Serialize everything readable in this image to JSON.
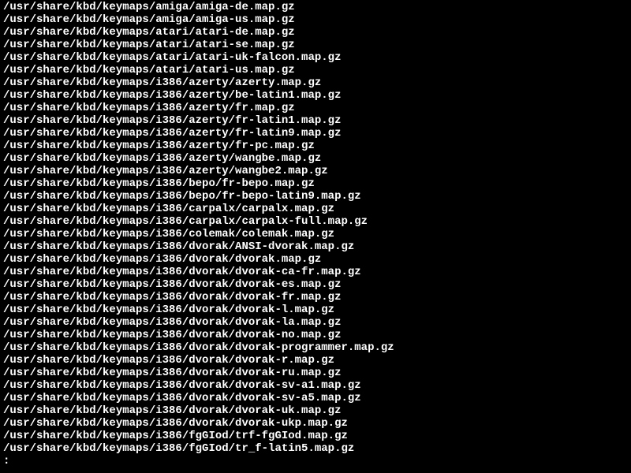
{
  "terminal": {
    "lines": [
      "/usr/share/kbd/keymaps/amiga/amiga-de.map.gz",
      "/usr/share/kbd/keymaps/amiga/amiga-us.map.gz",
      "/usr/share/kbd/keymaps/atari/atari-de.map.gz",
      "/usr/share/kbd/keymaps/atari/atari-se.map.gz",
      "/usr/share/kbd/keymaps/atari/atari-uk-falcon.map.gz",
      "/usr/share/kbd/keymaps/atari/atari-us.map.gz",
      "/usr/share/kbd/keymaps/i386/azerty/azerty.map.gz",
      "/usr/share/kbd/keymaps/i386/azerty/be-latin1.map.gz",
      "/usr/share/kbd/keymaps/i386/azerty/fr.map.gz",
      "/usr/share/kbd/keymaps/i386/azerty/fr-latin1.map.gz",
      "/usr/share/kbd/keymaps/i386/azerty/fr-latin9.map.gz",
      "/usr/share/kbd/keymaps/i386/azerty/fr-pc.map.gz",
      "/usr/share/kbd/keymaps/i386/azerty/wangbe.map.gz",
      "/usr/share/kbd/keymaps/i386/azerty/wangbe2.map.gz",
      "/usr/share/kbd/keymaps/i386/bepo/fr-bepo.map.gz",
      "/usr/share/kbd/keymaps/i386/bepo/fr-bepo-latin9.map.gz",
      "/usr/share/kbd/keymaps/i386/carpalx/carpalx.map.gz",
      "/usr/share/kbd/keymaps/i386/carpalx/carpalx-full.map.gz",
      "/usr/share/kbd/keymaps/i386/colemak/colemak.map.gz",
      "/usr/share/kbd/keymaps/i386/dvorak/ANSI-dvorak.map.gz",
      "/usr/share/kbd/keymaps/i386/dvorak/dvorak.map.gz",
      "/usr/share/kbd/keymaps/i386/dvorak/dvorak-ca-fr.map.gz",
      "/usr/share/kbd/keymaps/i386/dvorak/dvorak-es.map.gz",
      "/usr/share/kbd/keymaps/i386/dvorak/dvorak-fr.map.gz",
      "/usr/share/kbd/keymaps/i386/dvorak/dvorak-l.map.gz",
      "/usr/share/kbd/keymaps/i386/dvorak/dvorak-la.map.gz",
      "/usr/share/kbd/keymaps/i386/dvorak/dvorak-no.map.gz",
      "/usr/share/kbd/keymaps/i386/dvorak/dvorak-programmer.map.gz",
      "/usr/share/kbd/keymaps/i386/dvorak/dvorak-r.map.gz",
      "/usr/share/kbd/keymaps/i386/dvorak/dvorak-ru.map.gz",
      "/usr/share/kbd/keymaps/i386/dvorak/dvorak-sv-a1.map.gz",
      "/usr/share/kbd/keymaps/i386/dvorak/dvorak-sv-a5.map.gz",
      "/usr/share/kbd/keymaps/i386/dvorak/dvorak-uk.map.gz",
      "/usr/share/kbd/keymaps/i386/dvorak/dvorak-ukp.map.gz",
      "/usr/share/kbd/keymaps/i386/fgGIod/trf-fgGIod.map.gz",
      "/usr/share/kbd/keymaps/i386/fgGIod/tr_f-latin5.map.gz",
      ":"
    ]
  }
}
